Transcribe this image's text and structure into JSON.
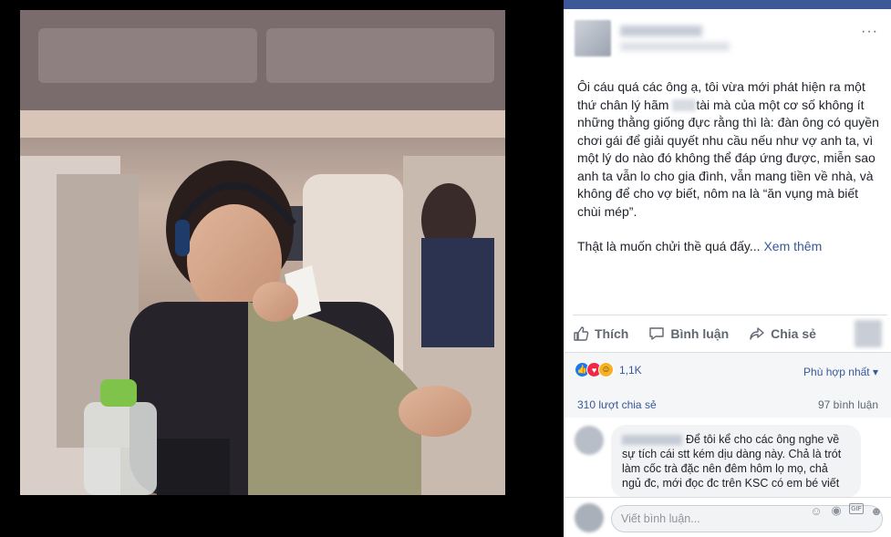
{
  "post": {
    "more_label": "···",
    "text_part1": "Ôi cáu quá các ông ạ, tôi vừa mới phát hiện ra một thứ chân lý hãm",
    "text_part2": "tài mà của một cơ số không ít những thằng giống đực rằng thì là: đàn ông có quyền chơi gái để giải quyết nhu cầu nếu như vợ anh ta, vì một lý do nào đó không thể đáp ứng được, miễn sao anh ta vẫn lo cho gia đình, vẫn mang tiền về nhà, và không để cho vợ biết, nôm na là “ăn vụng mà biết chùi mép”.",
    "text_para2": "Thật là muốn chửi thề quá đấy...",
    "see_more": "Xem thêm"
  },
  "actions": {
    "like": "Thích",
    "comment": "Bình luận",
    "share": "Chia sẻ"
  },
  "stats": {
    "reactions_count": "1,1K",
    "sort_label": "Phù hợp nhất",
    "shares": "310 lượt chia sẻ",
    "comments": "97 bình luận"
  },
  "comment": {
    "text": "Để tôi kể cho các ông nghe về sự tích cái stt kém dịu dàng này. Chả là trót làm cốc trà đặc nên đêm hôm lọ mọ, chả ngủ đc, mới đọc đc trên KSC có em bé viết"
  },
  "composer": {
    "placeholder": "Viết bình luận..."
  },
  "colors": {
    "link": "#385898",
    "like": "#1877f2",
    "love": "#f0284a",
    "haha": "#f7b125"
  }
}
